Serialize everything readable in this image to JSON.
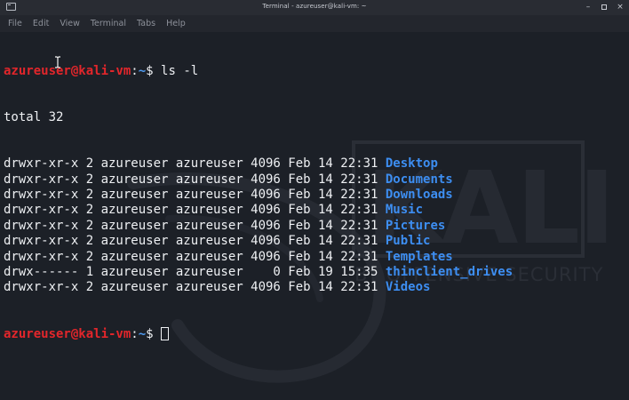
{
  "window": {
    "title": "Terminal - azureuser@kali-vm: ~",
    "controls": {
      "minimize": "–",
      "maximize": "□",
      "close": "×"
    }
  },
  "menu": [
    "File",
    "Edit",
    "View",
    "Terminal",
    "Tabs",
    "Help"
  ],
  "prompt": {
    "user_host": "azureuser@kali-vm",
    "separator": ":",
    "path": "~",
    "symbol": "$ "
  },
  "command": "ls -l",
  "total_line": "total 32",
  "listing": [
    {
      "perms": "drwxr-xr-x",
      "links": "2",
      "owner": "azureuser",
      "group": "azureuser",
      "size": "4096",
      "month": "Feb",
      "day": "14",
      "time": "22:31",
      "name": "Desktop"
    },
    {
      "perms": "drwxr-xr-x",
      "links": "2",
      "owner": "azureuser",
      "group": "azureuser",
      "size": "4096",
      "month": "Feb",
      "day": "14",
      "time": "22:31",
      "name": "Documents"
    },
    {
      "perms": "drwxr-xr-x",
      "links": "2",
      "owner": "azureuser",
      "group": "azureuser",
      "size": "4096",
      "month": "Feb",
      "day": "14",
      "time": "22:31",
      "name": "Downloads"
    },
    {
      "perms": "drwxr-xr-x",
      "links": "2",
      "owner": "azureuser",
      "group": "azureuser",
      "size": "4096",
      "month": "Feb",
      "day": "14",
      "time": "22:31",
      "name": "Music"
    },
    {
      "perms": "drwxr-xr-x",
      "links": "2",
      "owner": "azureuser",
      "group": "azureuser",
      "size": "4096",
      "month": "Feb",
      "day": "14",
      "time": "22:31",
      "name": "Pictures"
    },
    {
      "perms": "drwxr-xr-x",
      "links": "2",
      "owner": "azureuser",
      "group": "azureuser",
      "size": "4096",
      "month": "Feb",
      "day": "14",
      "time": "22:31",
      "name": "Public"
    },
    {
      "perms": "drwxr-xr-x",
      "links": "2",
      "owner": "azureuser",
      "group": "azureuser",
      "size": "4096",
      "month": "Feb",
      "day": "14",
      "time": "22:31",
      "name": "Templates"
    },
    {
      "perms": "drwx------",
      "links": "1",
      "owner": "azureuser",
      "group": "azureuser",
      "size": "0",
      "month": "Feb",
      "day": "19",
      "time": "15:35",
      "name": "thinclient_drives"
    },
    {
      "perms": "drwxr-xr-x",
      "links": "2",
      "owner": "azureuser",
      "group": "azureuser",
      "size": "4096",
      "month": "Feb",
      "day": "14",
      "time": "22:31",
      "name": "Videos"
    }
  ],
  "watermark": {
    "logo_text": "KALI",
    "tagline": "BY OFFENSIVE SECURITY"
  },
  "colors": {
    "background": "#1c2027",
    "prompt_user": "#e2262b",
    "prompt_path": "#4f9cf2",
    "directory": "#3d8ef2",
    "text": "#eef0f3"
  },
  "icons": {
    "title_icon": "terminal-icon",
    "mouse_pointer": "text-cursor-icon"
  }
}
